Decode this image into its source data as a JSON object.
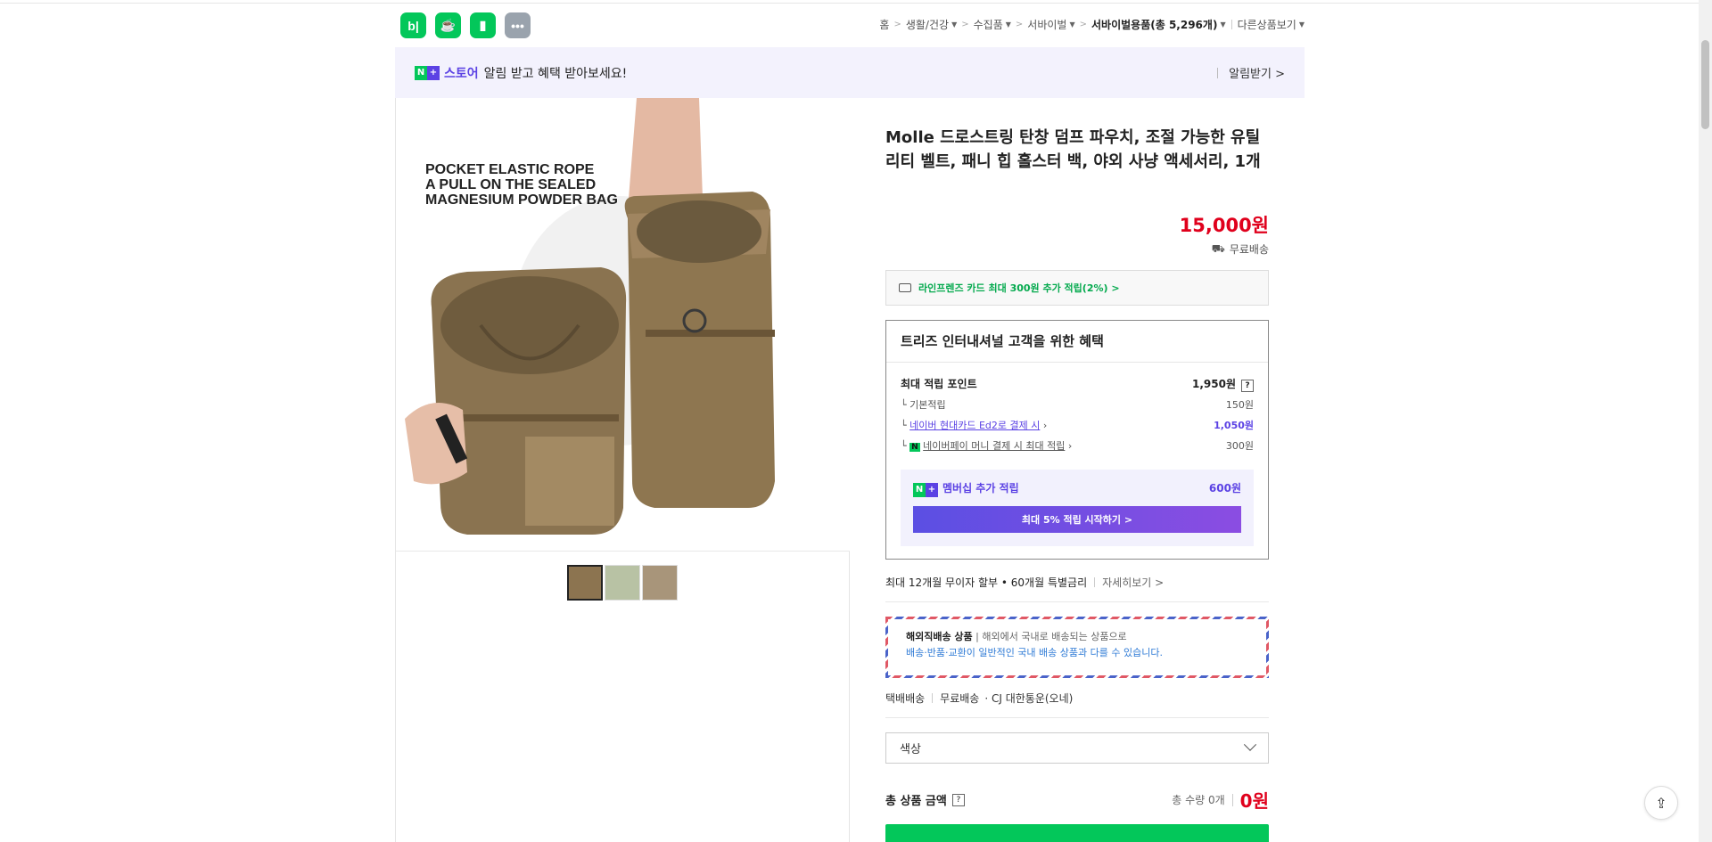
{
  "apps": [
    {
      "label": "b|",
      "icon": "blog-icon"
    },
    {
      "label": "☕",
      "icon": "cafe-icon"
    },
    {
      "label": "▮",
      "icon": "bookmark-icon"
    },
    {
      "label": "•••",
      "icon": "more-icon"
    }
  ],
  "breadcrumb": {
    "home": "홈",
    "c1": "생활/건강",
    "c2": "수집품",
    "c3": "서바이벌",
    "c4": "서바이벌용품(총 5,296개)",
    "other": "다른상품보기"
  },
  "banner": {
    "store": "스토어",
    "message": "알림 받고 혜택 받아보세요!",
    "alarm": "알림받기 >"
  },
  "product": {
    "image_text": [
      "POCKET ELASTIC ROPE",
      "A PULL ON THE SEALED",
      "MAGNESIUM POWDER BAG"
    ],
    "title": "Molle 드로스트링 탄창 덤프 파우치, 조절 가능한 유틸리티 벨트, 패니 힙 홀스터 백, 야외 사냥 액세서리, 1개",
    "price": "15,000원",
    "shipping": "무료배송"
  },
  "card_offer": "라인프렌즈 카드 최대 300원 추가 적립(2%) >",
  "benefit": {
    "title": "트리즈 인터내셔널 고객을 위한 혜택",
    "max_points_label": "최대 적립 포인트",
    "max_points_value": "1,950원",
    "basic_label": "기본적립",
    "basic_value": "150원",
    "hyundai_label": "네이버 현대카드 Ed2로 결제 시",
    "hyundai_value": "1,050원",
    "npay_label": "네이버페이 머니 결제 시 최대 적립",
    "npay_value": "300원",
    "member_label": "멤버십 추가 적립",
    "member_value": "600원",
    "member_button": "최대 5% 적립 시작하기 >"
  },
  "installment": {
    "text": "최대 12개월 무이자 할부 • 60개월 특별금리",
    "more": "자세히보기 >"
  },
  "overseas": {
    "title": "해외직배송 상품",
    "desc1": "해외에서 국내로 배송되는 상품으로",
    "desc2": "배송·반품·교환이 일반적인 국내 배송 상품과 다를 수 있습니다."
  },
  "delivery": {
    "type": "택배배송",
    "fee": "무료배송",
    "carrier": "· CJ 대한통운(오네)"
  },
  "option_select": "색상",
  "total": {
    "label": "총 상품 금액",
    "qty": "총 수량 0개",
    "amount": "0원"
  },
  "colors": {
    "naver_green": "#03c75a",
    "price_red": "#e0001c",
    "accent_purple": "#5b42e4"
  }
}
